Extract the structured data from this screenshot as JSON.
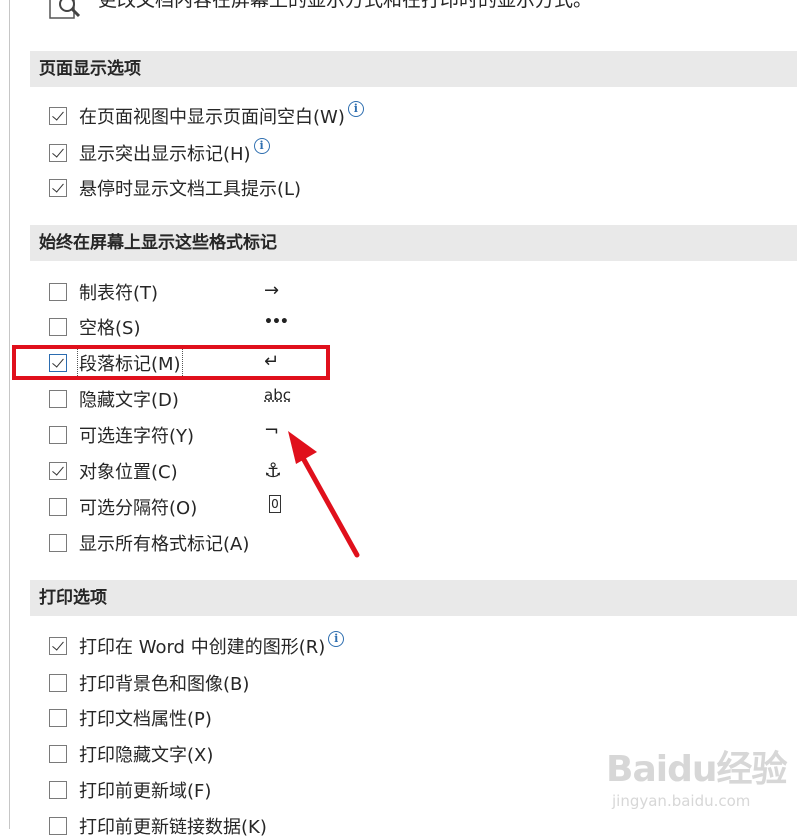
{
  "top": {
    "description": "更改文档内容在屏幕上的显示方式和在打印时的显示方式。"
  },
  "sections": {
    "page_display": {
      "title": "页面显示选项"
    },
    "formatting_marks": {
      "title": "始终在屏幕上显示这些格式标记"
    },
    "print": {
      "title": "打印选项"
    }
  },
  "page_display_options": [
    {
      "label": "在页面视图中显示页面间空白(W)",
      "checked": true,
      "info": "i"
    },
    {
      "label": "显示突出显示标记(H)",
      "checked": true,
      "info": "i"
    },
    {
      "label": "悬停时显示文档工具提示(L)",
      "checked": true
    }
  ],
  "formatting_marks_options": [
    {
      "label": "制表符(T)",
      "checked": false,
      "symbol": "→"
    },
    {
      "label": "空格(S)",
      "checked": false,
      "symbol": "•••"
    },
    {
      "label": "段落标记(M)",
      "checked": true,
      "symbol": "↵"
    },
    {
      "label": "隐藏文字(D)",
      "checked": false,
      "symbol": "abc"
    },
    {
      "label": "可选连字符(Y)",
      "checked": false,
      "symbol": "¬"
    },
    {
      "label": "对象位置(C)",
      "checked": true,
      "symbol": "⚓"
    },
    {
      "label": "可选分隔符(O)",
      "checked": false,
      "symbol": "0"
    },
    {
      "label": "显示所有格式标记(A)",
      "checked": false
    }
  ],
  "print_options": [
    {
      "label": "打印在 Word 中创建的图形(R)",
      "checked": true,
      "info": "i"
    },
    {
      "label": "打印背景色和图像(B)",
      "checked": false
    },
    {
      "label": "打印文档属性(P)",
      "checked": false
    },
    {
      "label": "打印隐藏文字(X)",
      "checked": false
    },
    {
      "label": "打印前更新域(F)",
      "checked": false
    },
    {
      "label": "打印前更新链接数据(K)",
      "checked": false
    }
  ],
  "watermark": {
    "brand": "Baidu经验",
    "url": "jingyan.baidu.com"
  },
  "colors": {
    "annotation_red": "#e0101c",
    "section_bg": "#e9e9e9"
  }
}
